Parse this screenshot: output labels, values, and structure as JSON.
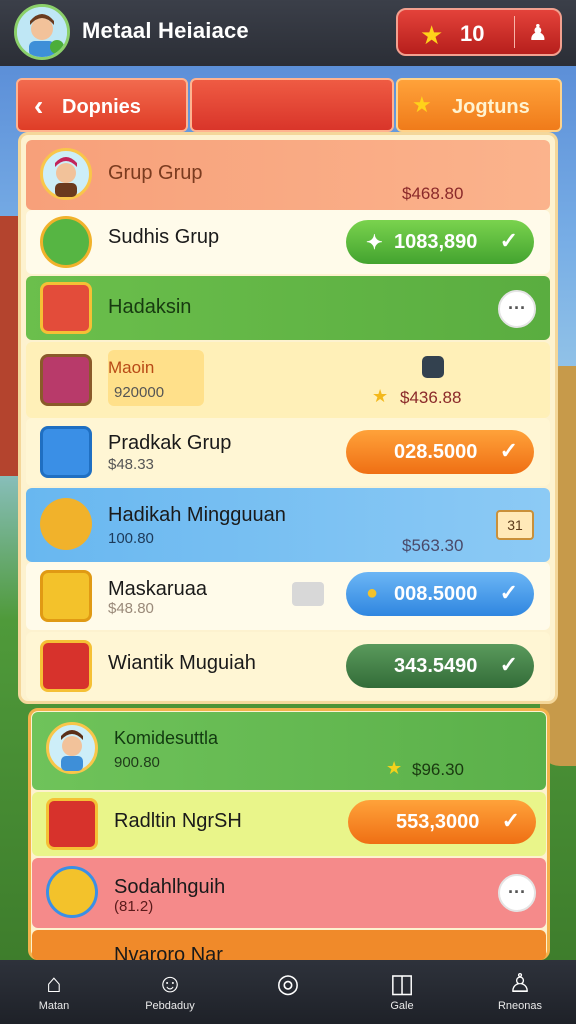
{
  "app": {
    "title": "Metaal Heiaiace",
    "stars": "10"
  },
  "tabs": {
    "back_label": "Dopnies",
    "right_label": "Jogtuns"
  },
  "rows": [
    {
      "title": "Grup Grup",
      "amount": "$468.80"
    },
    {
      "title": "Sudhis Grup",
      "pill": "1083,890"
    },
    {
      "title": "Hadaksin"
    },
    {
      "title": "Maoin",
      "sub": "920000",
      "amount": "$436.88"
    },
    {
      "title": "Pradkak Grup",
      "sub": "$48.33",
      "pill": "028.5000"
    },
    {
      "title": "Hadikah Mingguuan",
      "sub": "100.80",
      "amount": "$563.30",
      "badge": "31"
    },
    {
      "title": "Maskaruaa",
      "sub": "$48.80",
      "pill": "008.5000"
    },
    {
      "title": "Wiantik Muguiah",
      "pill": "343.5490"
    }
  ],
  "rows_b": [
    {
      "title": "Komidesuttla",
      "sub": "900.80",
      "amount": "$96.30"
    },
    {
      "title": "Radltin NgrSH",
      "pill": "553,3000"
    },
    {
      "title": "Sodahlhguih",
      "sub": "(81.2)"
    },
    {
      "title": "Nvaroro Nar"
    }
  ],
  "nav": [
    {
      "label": "Matan",
      "icon": "home-icon"
    },
    {
      "label": "Pebdaduy",
      "icon": "chef-icon"
    },
    {
      "label": "",
      "icon": "compass-icon"
    },
    {
      "label": "Gale",
      "icon": "cube-icon"
    },
    {
      "label": "Rneonas",
      "icon": "profile-icon"
    }
  ],
  "colors": {
    "topbar": "#2b2e36",
    "tab_red": "#df3d27",
    "tab_orange": "#f07b1a",
    "pill_green": "#4ab03a",
    "pill_orange": "#f07d1c",
    "pill_blue": "#3a8fe6",
    "pill_dark_green": "#3b7f3e"
  }
}
